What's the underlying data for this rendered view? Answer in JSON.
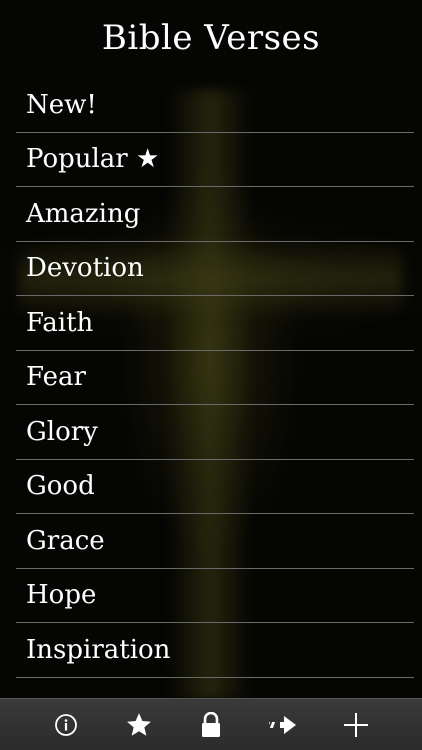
{
  "header": {
    "title": "Bible Verses"
  },
  "categories": [
    "New!",
    "Popular ★",
    "Amazing",
    "Devotion",
    "Faith",
    "Fear",
    "Glory",
    "Good",
    "Grace",
    "Hope",
    "Inspiration"
  ],
  "toolbar": {
    "buttons": [
      {
        "icon": "info-icon"
      },
      {
        "icon": "star-icon"
      },
      {
        "icon": "lock-icon"
      },
      {
        "icon": "share-arrow-icon"
      },
      {
        "icon": "plus-icon"
      }
    ]
  },
  "colors": {
    "background": "#050503",
    "text": "#ffffff",
    "divider": "#6a6a6a",
    "toolbar": "#333333"
  }
}
